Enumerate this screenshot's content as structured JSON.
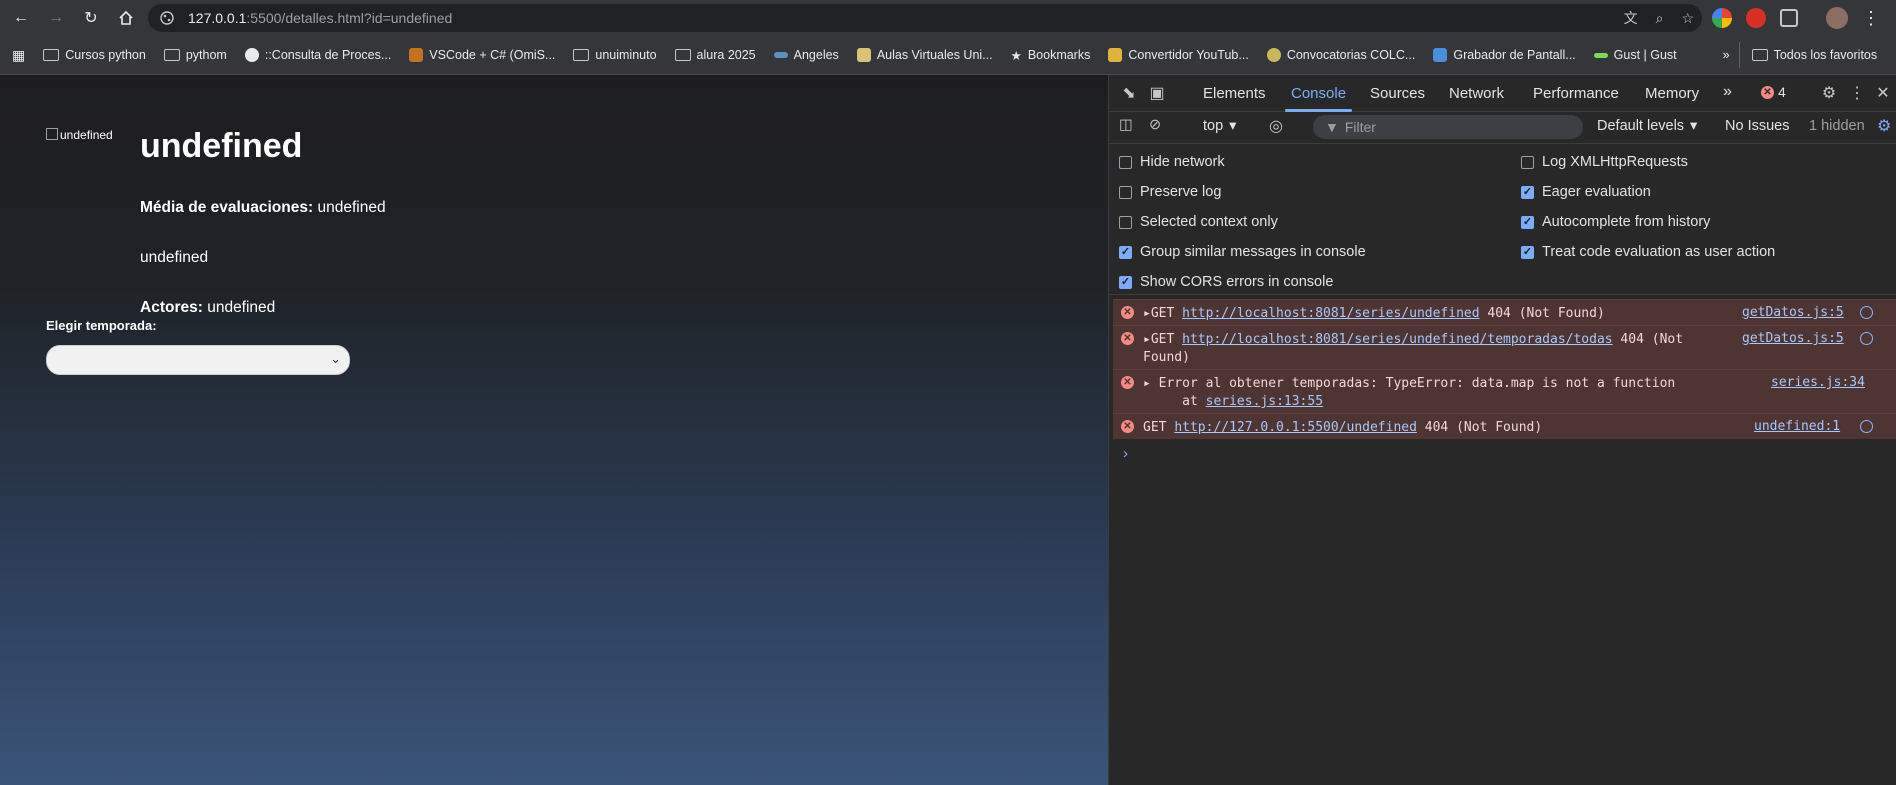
{
  "browser": {
    "url_host": "127.0.0.1",
    "url_rest": ":5500/detalles.html?id=undefined"
  },
  "bookmarks": {
    "items": [
      "Cursos python",
      "pythom",
      "::Consulta de Proces...",
      "VSCode + C# (OmiS...",
      "unuiminuto",
      "alura 2025",
      "Angeles",
      "Aulas Virtuales Uni...",
      "Bookmarks",
      "Convertidor YouTub...",
      "Convocatorias COLC...",
      "Grabador de Pantall...",
      "Gust | Gust"
    ],
    "all_favorites": "Todos los favoritos"
  },
  "page": {
    "poster_alt": "undefined",
    "title": "undefined",
    "rating_label": "Média de evaluaciones:",
    "rating_value": "undefined",
    "synopsis": "undefined",
    "actors_label": "Actores:",
    "actors_value": "undefined",
    "season_label": "Elegir temporada:",
    "season_selected": ""
  },
  "devtools": {
    "tabs": [
      "Elements",
      "Console",
      "Sources",
      "Network",
      "Performance",
      "Memory"
    ],
    "active_tab": "Console",
    "error_count": "4",
    "context": "top",
    "filter_placeholder": "Filter",
    "levels": "Default levels",
    "issues": "No Issues",
    "hidden": "1 hidden",
    "settings": {
      "hide_network": "Hide network",
      "preserve_log": "Preserve log",
      "selected_context": "Selected context only",
      "group_similar": "Group similar messages in console",
      "show_cors": "Show CORS errors in console",
      "log_xhr": "Log XMLHttpRequests",
      "eager_eval": "Eager evaluation",
      "autocomplete": "Autocomplete from history",
      "treat_code": "Treat code evaluation as user action"
    },
    "messages": [
      {
        "prefix": "GET ",
        "url": "http://localhost:8081/series/undefined",
        "suffix": " 404 (Not Found)",
        "source": "getDatos.js:5"
      },
      {
        "prefix": "GET ",
        "url": "http://localhost:8081/series/undefined/temporadas/todas",
        "suffix": " 404 (Not",
        "suffix2": "Found)",
        "source": "getDatos.js:5"
      },
      {
        "prefix": "Error al obtener temporadas: TypeError: data.map is not a function",
        "at": "    at ",
        "at_link": "series.js:13:55",
        "source": "series.js:34"
      },
      {
        "prefix": "GET ",
        "url": "http://127.0.0.1:5500/undefined",
        "suffix": " 404 (Not Found)",
        "source": "undefined:1"
      }
    ]
  },
  "colors": {
    "accent": "#7cacf8",
    "error": "#f28b82",
    "error_bg": "#4e3534"
  }
}
